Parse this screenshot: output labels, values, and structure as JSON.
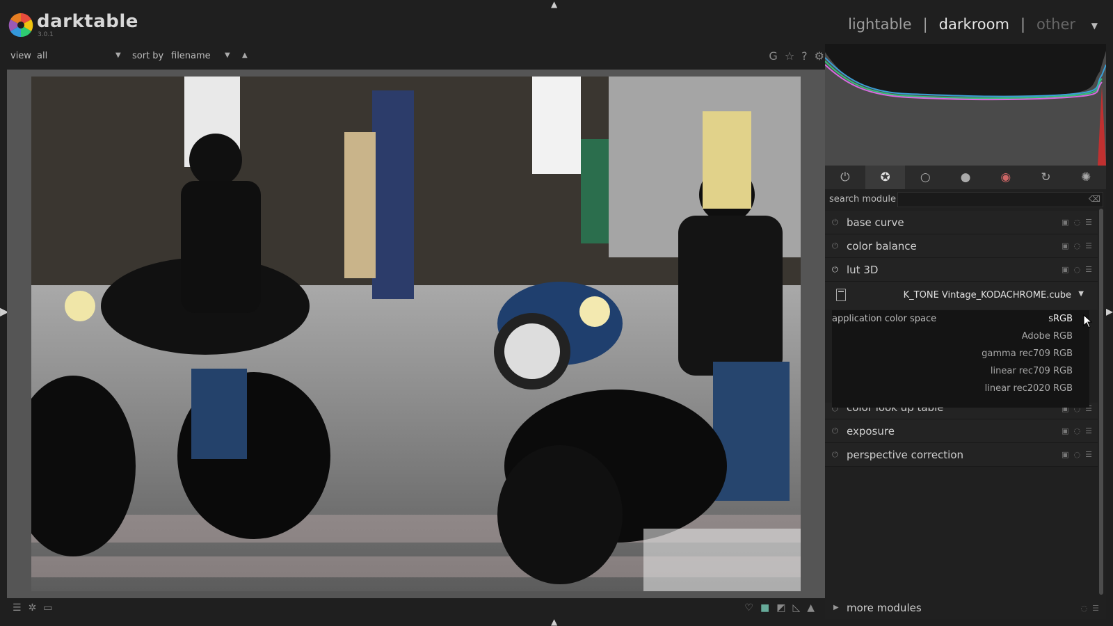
{
  "app": {
    "name": "darktable",
    "version": "3.0.1"
  },
  "views": [
    {
      "label": "lightable",
      "state": "normal"
    },
    {
      "label": "darkroom",
      "state": "active"
    },
    {
      "label": "other",
      "state": "dim"
    }
  ],
  "filter": {
    "view_label": "view",
    "view_value": "all",
    "sort_label": "sort by",
    "sort_value": "filename"
  },
  "top_tools": [
    "G",
    "☆",
    "?",
    "⚙"
  ],
  "module_groups": [
    {
      "icon": "power-icon",
      "glyph": "⏻"
    },
    {
      "icon": "favorites-icon",
      "glyph": "✪"
    },
    {
      "icon": "circle-icon",
      "glyph": "○"
    },
    {
      "icon": "tone-icon",
      "glyph": "●"
    },
    {
      "icon": "color-icon",
      "glyph": "◉"
    },
    {
      "icon": "correct-icon",
      "glyph": "↻"
    },
    {
      "icon": "effect-icon",
      "glyph": "✺"
    }
  ],
  "search": {
    "label": "search module",
    "value": ""
  },
  "modules": [
    {
      "name": "base curve",
      "on": false
    },
    {
      "name": "color balance",
      "on": false
    },
    {
      "name": "lut 3D",
      "on": true
    }
  ],
  "lut": {
    "file": "K_TONE Vintage_KODACHROME.cube"
  },
  "color_space_dropdown": {
    "label": "application color space",
    "options": [
      "sRGB",
      "Adobe RGB",
      "gamma rec709 RGB",
      "linear rec709 RGB",
      "linear rec2020 RGB"
    ],
    "selected": "sRGB"
  },
  "modules_after": [
    {
      "name": "color look up table",
      "on": false,
      "partial": true
    },
    {
      "name": "exposure",
      "on": false
    },
    {
      "name": "perspective correction",
      "on": false
    }
  ],
  "more_modules": {
    "label": "more modules"
  },
  "colors": {
    "accent": "#e6e6e6",
    "panel": "#202020",
    "background": "#1f1f1f"
  }
}
